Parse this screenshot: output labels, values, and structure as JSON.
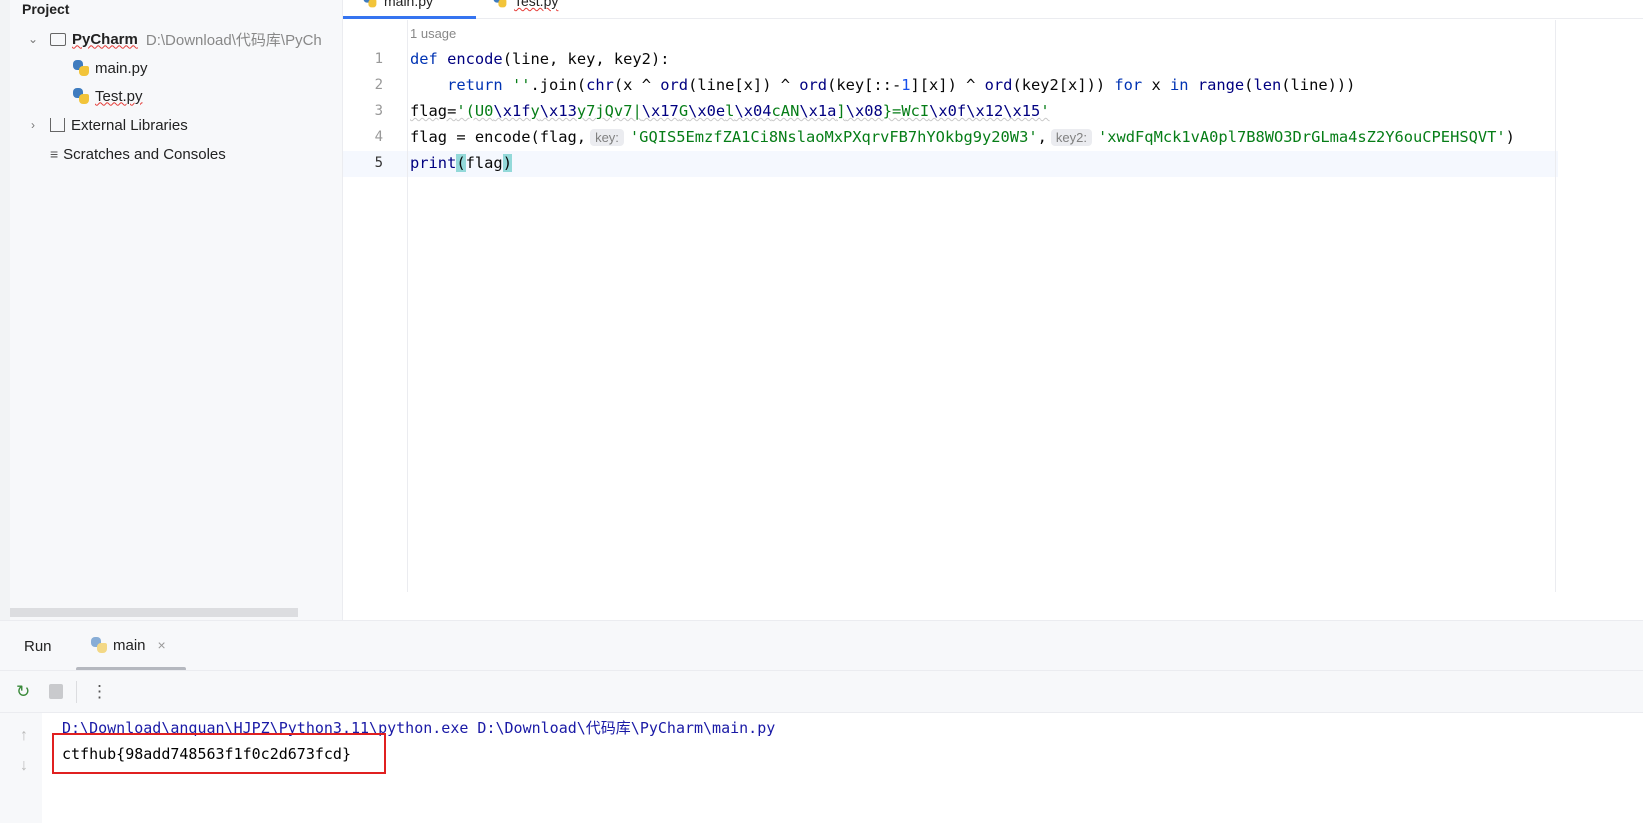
{
  "project_panel": {
    "title": "Project",
    "root": {
      "name": "PyCharm",
      "path": "D:\\Download\\代码库\\PyCh"
    },
    "files": [
      {
        "name": "main.py"
      },
      {
        "name": "Test.py"
      }
    ],
    "external_libraries": "External Libraries",
    "scratches": "Scratches and Consoles"
  },
  "editor": {
    "tabs": [
      {
        "label": "main.py",
        "active": true
      },
      {
        "label": "Test.py",
        "active": false
      }
    ],
    "usage_hint": "1 usage",
    "line_numbers": [
      "1",
      "2",
      "3",
      "4",
      "5"
    ],
    "current_line": 5,
    "lines": [
      [
        {
          "t": "def ",
          "c": "kw"
        },
        {
          "t": "encode",
          "c": "bi"
        },
        {
          "t": "(line, key, key2):",
          "c": ""
        }
      ],
      [
        {
          "t": "    return ",
          "c": "kw"
        },
        {
          "t": "''",
          "c": "st"
        },
        {
          "t": ".join(",
          "c": ""
        },
        {
          "t": "chr",
          "c": "bi"
        },
        {
          "t": "(x ^ ",
          "c": ""
        },
        {
          "t": "ord",
          "c": "bi"
        },
        {
          "t": "(line[x]) ^ ",
          "c": ""
        },
        {
          "t": "ord",
          "c": "bi"
        },
        {
          "t": "(key[::-",
          "c": ""
        },
        {
          "t": "1",
          "c": "num"
        },
        {
          "t": "][x]) ^ ",
          "c": ""
        },
        {
          "t": "ord",
          "c": "bi"
        },
        {
          "t": "(key2[x])) ",
          "c": ""
        },
        {
          "t": "for ",
          "c": "kw"
        },
        {
          "t": "x ",
          "c": ""
        },
        {
          "t": "in ",
          "c": "kw"
        },
        {
          "t": "range",
          "c": "bi"
        },
        {
          "t": "(",
          "c": ""
        },
        {
          "t": "len",
          "c": "bi"
        },
        {
          "t": "(line)))",
          "c": ""
        }
      ],
      [
        {
          "t": "flag=",
          "c": "wv"
        },
        {
          "t": "'(U0",
          "c": "st wv"
        },
        {
          "t": "\\x1f",
          "c": "bi wv"
        },
        {
          "t": "y",
          "c": "st wv"
        },
        {
          "t": "\\x13",
          "c": "bi wv"
        },
        {
          "t": "y7jQv7|",
          "c": "st wv"
        },
        {
          "t": "\\x17",
          "c": "bi wv"
        },
        {
          "t": "G",
          "c": "st wv"
        },
        {
          "t": "\\x0e",
          "c": "bi wv"
        },
        {
          "t": "l",
          "c": "st wv"
        },
        {
          "t": "\\x04",
          "c": "bi wv"
        },
        {
          "t": "cAN",
          "c": "st wv"
        },
        {
          "t": "\\x1a",
          "c": "bi wv"
        },
        {
          "t": "]",
          "c": "st wv"
        },
        {
          "t": "\\x08",
          "c": "bi wv"
        },
        {
          "t": "}=WcI",
          "c": "st wv"
        },
        {
          "t": "\\x0f\\x12\\x15",
          "c": "bi wv"
        },
        {
          "t": "'",
          "c": "st wv"
        }
      ],
      [
        {
          "t": "flag = encode(flag,",
          "c": ""
        },
        {
          "t": "key:",
          "c": "hint"
        },
        {
          "t": "'GQIS5EmzfZA1Ci8NslaoMxPXqrvFB7hYOkbg9y20W3'",
          "c": "st"
        },
        {
          "t": ",",
          "c": ""
        },
        {
          "t": "key2:",
          "c": "hint"
        },
        {
          "t": "'xwdFqMck1vA0pl7B8WO3DrGLma4sZ2Y6ouCPEHSQVT'",
          "c": "st"
        },
        {
          "t": ")",
          "c": ""
        }
      ],
      [
        {
          "t": "print",
          "c": "bi"
        },
        {
          "t": "(",
          "c": "brace"
        },
        {
          "t": "flag",
          "c": ""
        },
        {
          "t": ")",
          "c": "brace"
        }
      ]
    ]
  },
  "run_panel": {
    "title": "Run",
    "tab": "main",
    "close": "×",
    "toolbar": {
      "rerun": "rerun-icon",
      "stop": "stop-icon",
      "more": "⋮"
    },
    "output": [
      {
        "text": "D:\\Download\\anquan\\HJPZ\\Python3.11\\python.exe D:\\Download\\代码库\\PyCharm\\main.py",
        "color": "#1a1aa6"
      },
      {
        "text": "ctfhub{98add748563f1f0c2d673fcd}",
        "color": "#080808"
      }
    ],
    "highlight_color": "#e02020"
  }
}
